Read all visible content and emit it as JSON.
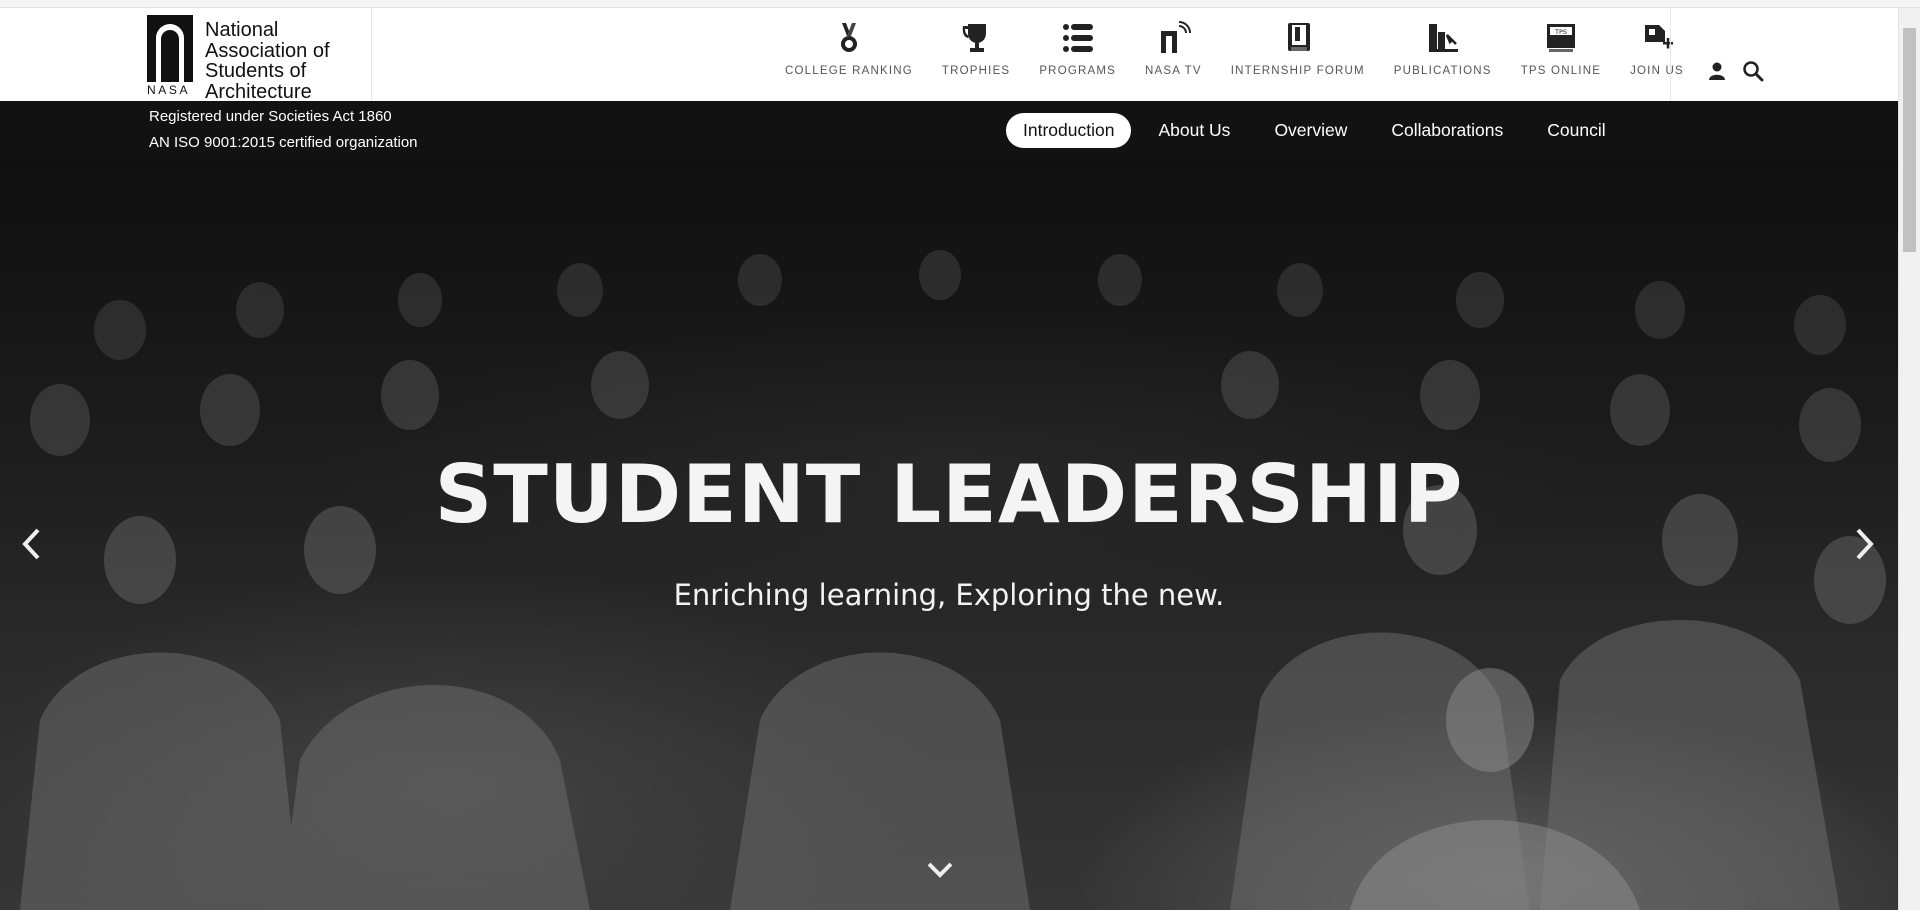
{
  "logo": {
    "acronym": "NASA",
    "name_lines": [
      "National",
      "Association of",
      "Students of",
      "Architecture"
    ]
  },
  "nav": {
    "items": [
      {
        "label": "COLLEGE RANKING",
        "icon": "medal-icon"
      },
      {
        "label": "TROPHIES",
        "icon": "trophy-icon"
      },
      {
        "label": "PROGRAMS",
        "icon": "list-icon"
      },
      {
        "label": "NASA TV",
        "icon": "tv-icon"
      },
      {
        "label": "INTERNSHIP FORUM",
        "icon": "briefcase-icon"
      },
      {
        "label": "PUBLICATIONS",
        "icon": "books-icon"
      },
      {
        "label": "TPS ONLINE",
        "icon": "tps-icon"
      },
      {
        "label": "JOIN US",
        "icon": "join-icon"
      }
    ]
  },
  "header_actions": {
    "user_icon": "user-icon",
    "search_icon": "search-icon"
  },
  "subbar": {
    "registration": "Registered under Societies Act 1860",
    "iso": "AN ISO 9001:2015 certified organization",
    "links": [
      {
        "label": "Introduction",
        "active": true
      },
      {
        "label": "About Us",
        "active": false
      },
      {
        "label": "Overview",
        "active": false
      },
      {
        "label": "Collaborations",
        "active": false
      },
      {
        "label": "Council",
        "active": false
      }
    ]
  },
  "hero": {
    "title": "STUDENT LEADERSHIP",
    "subtitle": "Enriching learning, Exploring the new.",
    "prev_icon": "chevron-left-icon",
    "next_icon": "chevron-right-icon",
    "scroll_icon": "chevron-down-icon"
  },
  "colors": {
    "header_bg": "#ffffff",
    "bar_bg": "#121212",
    "active_pill": "#ffffff",
    "hero_text": "#f4f4f4"
  }
}
